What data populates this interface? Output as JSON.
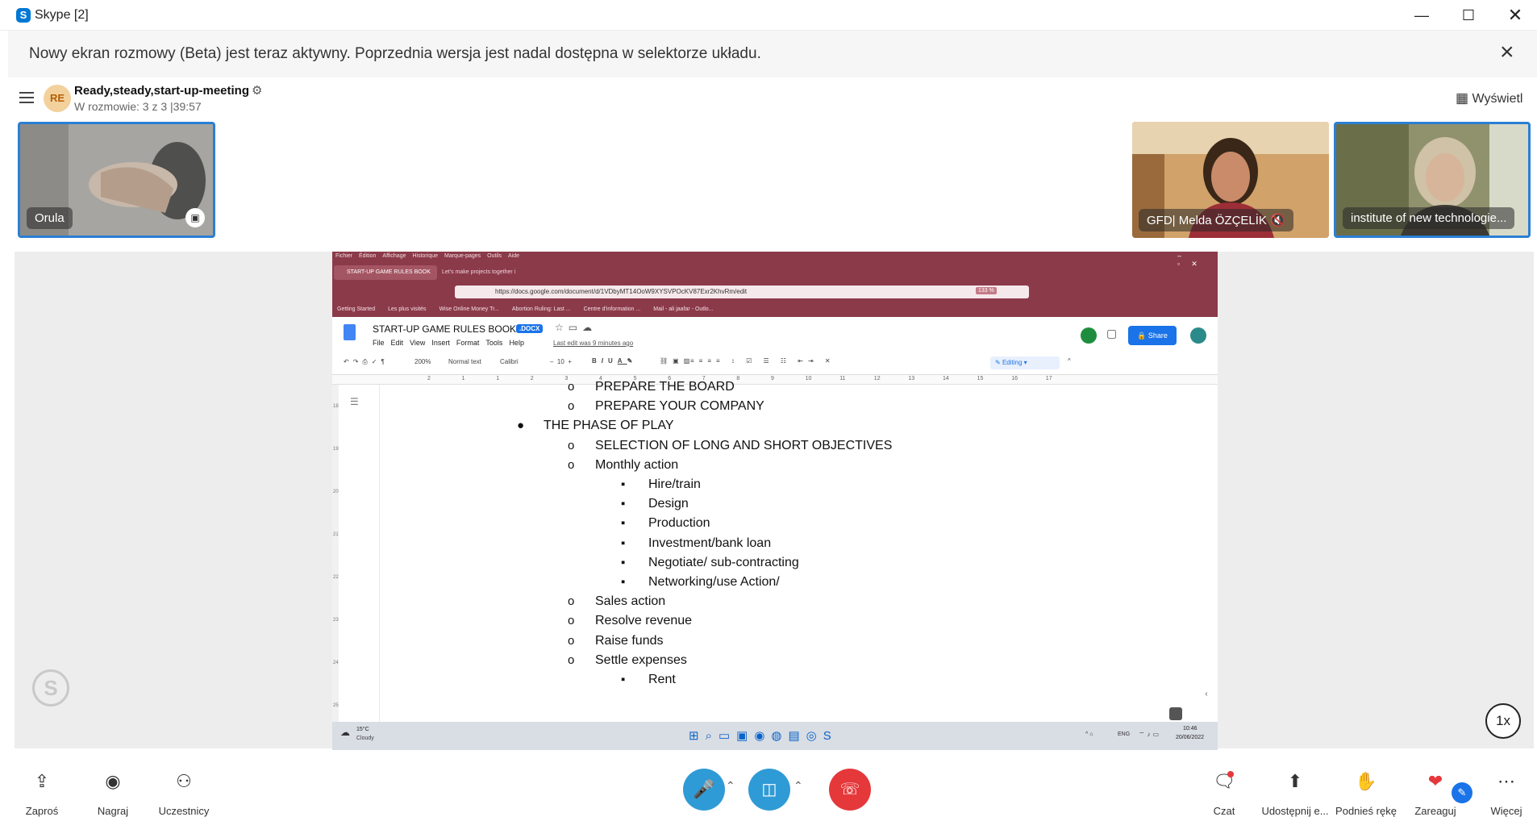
{
  "window": {
    "title": "Skype [2]",
    "minimize_icon": "minimize-icon",
    "maximize_icon": "maximize-icon",
    "close_icon": "close-icon"
  },
  "banner": {
    "text": "Nowy ekran rozmowy (Beta) jest teraz aktywny. Poprzednia wersja jest nadal dostępna w selektorze układu."
  },
  "call": {
    "avatar_initials": "RE",
    "name": "Ready,steady,start-up-meeting",
    "status": "W rozmowie: 3 z 3  |39:57",
    "view_label": "Wyświetl"
  },
  "participants": [
    {
      "name": "Orula"
    },
    {
      "name": "GFD| Melda ÖZÇELİK"
    },
    {
      "name": "institute of new technologie..."
    }
  ],
  "shared": {
    "firefox_menu": [
      "Fichier",
      "Édition",
      "Affichage",
      "Historique",
      "Marque-pages",
      "Outils",
      "Aide"
    ],
    "tabs": [
      {
        "label": "START-UP GAME RULES BOOK"
      },
      {
        "label": "Let's make projects together i"
      }
    ],
    "url": "https://docs.google.com/document/d/1VDbyMT14OoW9XYSVPOcKV87Exr2KhvRm/edit",
    "zoom": "133 %",
    "bookmarks": [
      "Getting Started",
      "Les plus visités",
      "Wise Online Money Tr...",
      "Abortion Ruling: Last ...",
      "Centre d'information ...",
      "Mail - ali jaafar - Outlo..."
    ],
    "doc_title": "START-UP GAME RULES BOOK",
    "doc_badge": ".DOCX",
    "doc_menu": [
      "File",
      "Edit",
      "View",
      "Insert",
      "Format",
      "Tools",
      "Help"
    ],
    "last_edit": "Last edit was 9 minutes ago",
    "share_label": "Share",
    "toolbar": {
      "zoom": "200%",
      "style": "Normal text",
      "font": "Calibri",
      "size": "10",
      "mode": "Editing"
    },
    "ruler": [
      "2",
      "1",
      "1",
      "2",
      "3",
      "4",
      "5",
      "6",
      "7",
      "8",
      "9",
      "10",
      "11",
      "12",
      "13",
      "14",
      "15",
      "16",
      "17"
    ],
    "left_ruler": [
      "18",
      "19",
      "20",
      "21",
      "22",
      "23",
      "24",
      "25"
    ],
    "lines": [
      {
        "marker": "o",
        "text": "PREPARE THE BOARD",
        "level": 1
      },
      {
        "marker": "o",
        "text": "PREPARE YOUR COMPANY",
        "level": 1
      },
      {
        "marker": "●",
        "text": "THE PHASE OF PLAY",
        "level": 0
      },
      {
        "marker": "o",
        "text": "SELECTION OF LONG AND SHORT OBJECTIVES",
        "level": 1
      },
      {
        "marker": "o",
        "text": "Monthly action",
        "level": 1
      },
      {
        "marker": "▪",
        "text": "Hire/train",
        "level": 2
      },
      {
        "marker": "▪",
        "text": "Design",
        "level": 2
      },
      {
        "marker": "▪",
        "text": "Production",
        "level": 2
      },
      {
        "marker": "▪",
        "text": "Investment/bank loan",
        "level": 2
      },
      {
        "marker": "▪",
        "text": "Negotiate/ sub-contracting",
        "level": 2
      },
      {
        "marker": "▪",
        "text": "Networking/use Action/",
        "level": 2
      },
      {
        "marker": "o",
        "text": "Sales action",
        "level": 1
      },
      {
        "marker": "o",
        "text": "Resolve revenue",
        "level": 1
      },
      {
        "marker": "o",
        "text": "Raise funds",
        "level": 1
      },
      {
        "marker": "o",
        "text": "Settle expenses",
        "level": 1
      },
      {
        "marker": "▪",
        "text": "Rent",
        "level": 2
      }
    ],
    "taskbar": {
      "weather_temp": "15°C",
      "weather_desc": "Cloudy",
      "lang": "ENG",
      "time": "10:46",
      "date": "20/06/2022"
    }
  },
  "speed": "1x",
  "toolbar": {
    "invite": "Zaproś",
    "record": "Nagraj",
    "participants": "Uczestnicy",
    "chat": "Czat",
    "share": "Udostępnij e...",
    "raise_hand": "Podnieś rękę",
    "react": "Zareaguj",
    "more": "Więcej"
  },
  "colors": {
    "skype_blue": "#0078d4",
    "call_button": "#2f9bd6",
    "hangup": "#e5383b",
    "firefox_frame": "#8b3a4a",
    "docs_blue": "#1a73e8"
  }
}
